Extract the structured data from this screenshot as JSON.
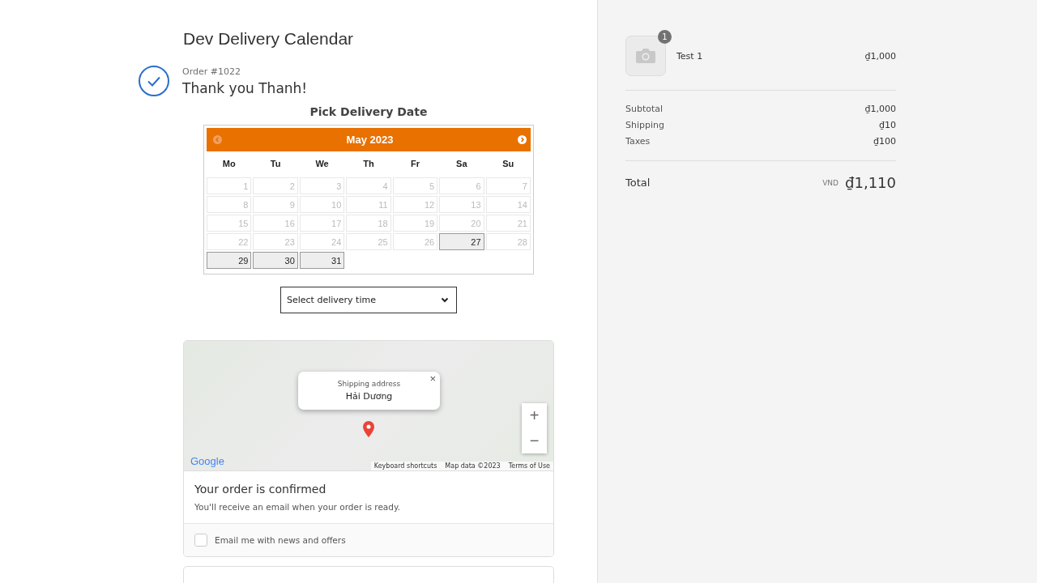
{
  "shop": {
    "title": "Dev Delivery Calendar"
  },
  "order": {
    "number": "Order #1022",
    "greeting": "Thank you Thanh!"
  },
  "delivery": {
    "heading": "Pick Delivery Date",
    "calendar": {
      "month": "May 2023",
      "prev": {
        "disabled": true
      },
      "next": {
        "disabled": false
      },
      "weekdays": [
        "Mo",
        "Tu",
        "We",
        "Th",
        "Fr",
        "Sa",
        "Su"
      ],
      "weeks": [
        [
          {
            "label": "1",
            "disabled": true
          },
          {
            "label": "2",
            "disabled": true
          },
          {
            "label": "3",
            "disabled": true
          },
          {
            "label": "4",
            "disabled": true
          },
          {
            "label": "5",
            "disabled": true
          },
          {
            "label": "6",
            "disabled": true
          },
          {
            "label": "7",
            "disabled": true
          }
        ],
        [
          {
            "label": "8",
            "disabled": true
          },
          {
            "label": "9",
            "disabled": true
          },
          {
            "label": "10",
            "disabled": true
          },
          {
            "label": "11",
            "disabled": true
          },
          {
            "label": "12",
            "disabled": true
          },
          {
            "label": "13",
            "disabled": true
          },
          {
            "label": "14",
            "disabled": true
          }
        ],
        [
          {
            "label": "15",
            "disabled": true
          },
          {
            "label": "16",
            "disabled": true
          },
          {
            "label": "17",
            "disabled": true
          },
          {
            "label": "18",
            "disabled": true
          },
          {
            "label": "19",
            "disabled": true
          },
          {
            "label": "20",
            "disabled": true
          },
          {
            "label": "21",
            "disabled": true
          }
        ],
        [
          {
            "label": "22",
            "disabled": true
          },
          {
            "label": "23",
            "disabled": true
          },
          {
            "label": "24",
            "disabled": true
          },
          {
            "label": "25",
            "disabled": true
          },
          {
            "label": "26",
            "disabled": true
          },
          {
            "label": "27",
            "disabled": false
          },
          {
            "label": "28",
            "disabled": true
          }
        ],
        [
          {
            "label": "29",
            "disabled": false
          },
          {
            "label": "30",
            "disabled": false
          },
          {
            "label": "31",
            "disabled": false
          }
        ]
      ]
    },
    "time_select": {
      "value": "Select delivery time"
    }
  },
  "map": {
    "popup": {
      "title": "Shipping address",
      "value": "Hải Dương",
      "close": "×"
    },
    "zoom_in": "+",
    "zoom_out": "−",
    "logo": "Google",
    "attributions": [
      "Keyboard shortcuts",
      "Map data ©2023",
      "Terms of Use"
    ]
  },
  "confirmation": {
    "title": "Your order is confirmed",
    "message": "You'll receive an email when your order is ready.",
    "newsletter": {
      "label": "Email me with news and offers",
      "checked": false
    }
  },
  "summary": {
    "items": [
      {
        "name": "Test 1",
        "quantity": "1",
        "price": "₫1,000"
      }
    ],
    "lines": [
      {
        "label": "Subtotal",
        "value": "₫1,000"
      },
      {
        "label": "Shipping",
        "value": "₫10"
      },
      {
        "label": "Taxes",
        "value": "₫100"
      }
    ],
    "total": {
      "label": "Total",
      "currency": "VND",
      "value": "₫1,110"
    }
  }
}
